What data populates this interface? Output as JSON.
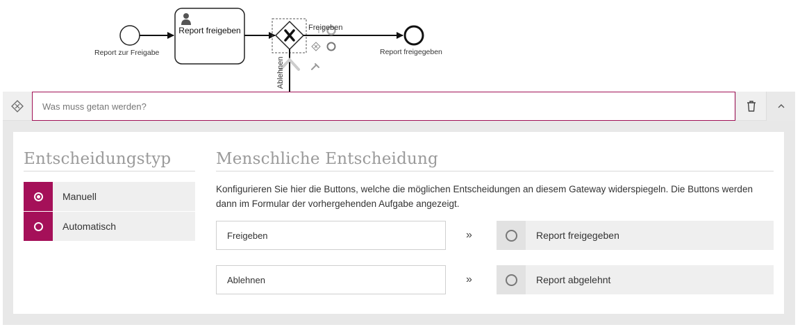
{
  "diagram": {
    "start_event_label": "Report zur Freigabe",
    "task_label": "Report freigeben",
    "end_event_label": "Report freigegeben",
    "flow_approve_label": "Freigeben",
    "flow_reject_label": "Ablehnen"
  },
  "panel": {
    "title_placeholder": "Was muss getan werden?",
    "title_value": "",
    "header_icon": "gateway-diamond-icon",
    "delete_icon": "trash-icon",
    "collapse_icon": "chevron-up-icon"
  },
  "decision_type": {
    "title": "Entscheidungstyp",
    "options": [
      {
        "label": "Manuell",
        "selected": true
      },
      {
        "label": "Automatisch",
        "selected": false
      }
    ]
  },
  "human_decision": {
    "title": "Menschliche Entscheidung",
    "description": "Konfigurieren Sie hier die Buttons, welche die möglichen Entscheidungen an diesem Gateway widerspiegeln. Die Buttons werden dann im Formular der vorhergehenden Aufgabe angezeigt.",
    "separator": "»",
    "decisions": [
      {
        "button_text": "Freigeben",
        "target": "Report freigegeben"
      },
      {
        "button_text": "Ablehnen",
        "target": "Report abgelehnt"
      }
    ]
  },
  "colors": {
    "accent": "#a51059",
    "panel_bg": "#e8e8e8",
    "item_bg": "#efefef"
  }
}
